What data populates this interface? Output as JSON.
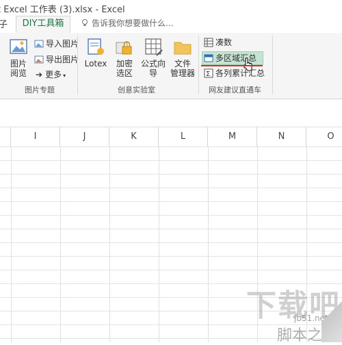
{
  "title_bar": {
    "text": "t Excel 工作表 (3).xlsx - Excel"
  },
  "tabs": {
    "left_partial": "子",
    "active": "DIY工具箱",
    "tell_me": "告诉我你想要做什么..."
  },
  "ribbon": {
    "groups": [
      {
        "label": "图片专题"
      },
      {
        "label": "创意实验室"
      },
      {
        "label": "网友建议直通车"
      }
    ],
    "picture_view": {
      "line1": "图片",
      "line2": "阅览"
    },
    "import_picture": "导入图片",
    "export_picture": "导出图片",
    "more": "更多",
    "lotex": "Lotex",
    "encrypt": {
      "line1": "加密",
      "line2": "选区"
    },
    "formula_wizard": {
      "line1": "公式向",
      "line2": "导"
    },
    "file_manager": {
      "line1": "文件",
      "line2": "管理器"
    },
    "make_up": "凑数",
    "multi_area_sum": "多区域汇总",
    "column_cumulative_sum": "各列累计汇总"
  },
  "columns": [
    "I",
    "J",
    "K",
    "L",
    "M",
    "N",
    "O"
  ],
  "watermark": {
    "big": "下载吧",
    "site": "jb51.net",
    "brand": "脚本之家"
  }
}
